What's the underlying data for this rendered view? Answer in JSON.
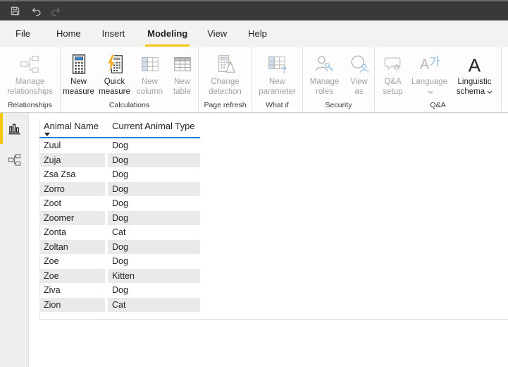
{
  "menu": {
    "items": [
      {
        "label": "File"
      },
      {
        "label": "Home"
      },
      {
        "label": "Insert"
      },
      {
        "label": "Modeling",
        "active": true
      },
      {
        "label": "View"
      },
      {
        "label": "Help"
      }
    ]
  },
  "ribbon": {
    "groups": [
      {
        "label": "Relationships",
        "buttons": [
          {
            "line1": "Manage",
            "line2": "relationships",
            "icon": "manage-relationships-icon",
            "disabled": true
          }
        ]
      },
      {
        "label": "Calculations",
        "buttons": [
          {
            "line1": "New",
            "line2": "measure",
            "icon": "new-measure-icon",
            "disabled": false
          },
          {
            "line1": "Quick",
            "line2": "measure",
            "icon": "quick-measure-icon",
            "disabled": false
          },
          {
            "line1": "New",
            "line2": "column",
            "icon": "new-column-icon",
            "disabled": true
          },
          {
            "line1": "New",
            "line2": "table",
            "icon": "new-table-icon",
            "disabled": true
          }
        ]
      },
      {
        "label": "Page refresh",
        "buttons": [
          {
            "line1": "Change",
            "line2": "detection",
            "icon": "change-detection-icon",
            "disabled": true
          }
        ]
      },
      {
        "label": "What if",
        "buttons": [
          {
            "line1": "New",
            "line2": "parameter",
            "icon": "new-parameter-icon",
            "disabled": true
          }
        ]
      },
      {
        "label": "Security",
        "buttons": [
          {
            "line1": "Manage",
            "line2": "roles",
            "icon": "manage-roles-icon",
            "disabled": true
          },
          {
            "line1": "View",
            "line2": "as",
            "icon": "view-as-icon",
            "disabled": true
          }
        ]
      },
      {
        "label": "Q&A",
        "buttons": [
          {
            "line1": "Q&A",
            "line2": "setup",
            "icon": "qa-setup-icon",
            "disabled": true
          },
          {
            "line1": "Language",
            "line2": "",
            "icon": "language-icon",
            "disabled": true,
            "dropdown": true
          },
          {
            "line1": "Linguistic",
            "line2": "schema",
            "icon": "linguistic-schema-icon",
            "disabled": false,
            "dropdown": true
          }
        ]
      }
    ]
  },
  "sidebar": {
    "items": [
      {
        "name": "report-view",
        "active": true
      },
      {
        "name": "model-view",
        "active": false
      }
    ]
  },
  "data_grid": {
    "columns": [
      {
        "label": "Animal Name",
        "sorted": "desc"
      },
      {
        "label": "Current Animal Type"
      }
    ],
    "rows": [
      [
        "Zuul",
        "Dog"
      ],
      [
        "Zuja",
        "Dog"
      ],
      [
        "Zsa Zsa",
        "Dog"
      ],
      [
        "Zorro",
        "Dog"
      ],
      [
        "Zoot",
        "Dog"
      ],
      [
        "Zoomer",
        "Dog"
      ],
      [
        "Zonta",
        "Cat"
      ],
      [
        "Zoltan",
        "Dog"
      ],
      [
        "Zoe",
        "Dog"
      ],
      [
        "Zoe",
        "Kitten"
      ],
      [
        "Ziva",
        "Dog"
      ],
      [
        "Zion",
        "Cat"
      ]
    ]
  },
  "colors": {
    "accent_yellow": "#F2C811",
    "header_underline_blue": "#2B7CD3",
    "alt_row_gray": "#EAEAEA",
    "titlebar_gray": "#3A3938"
  }
}
